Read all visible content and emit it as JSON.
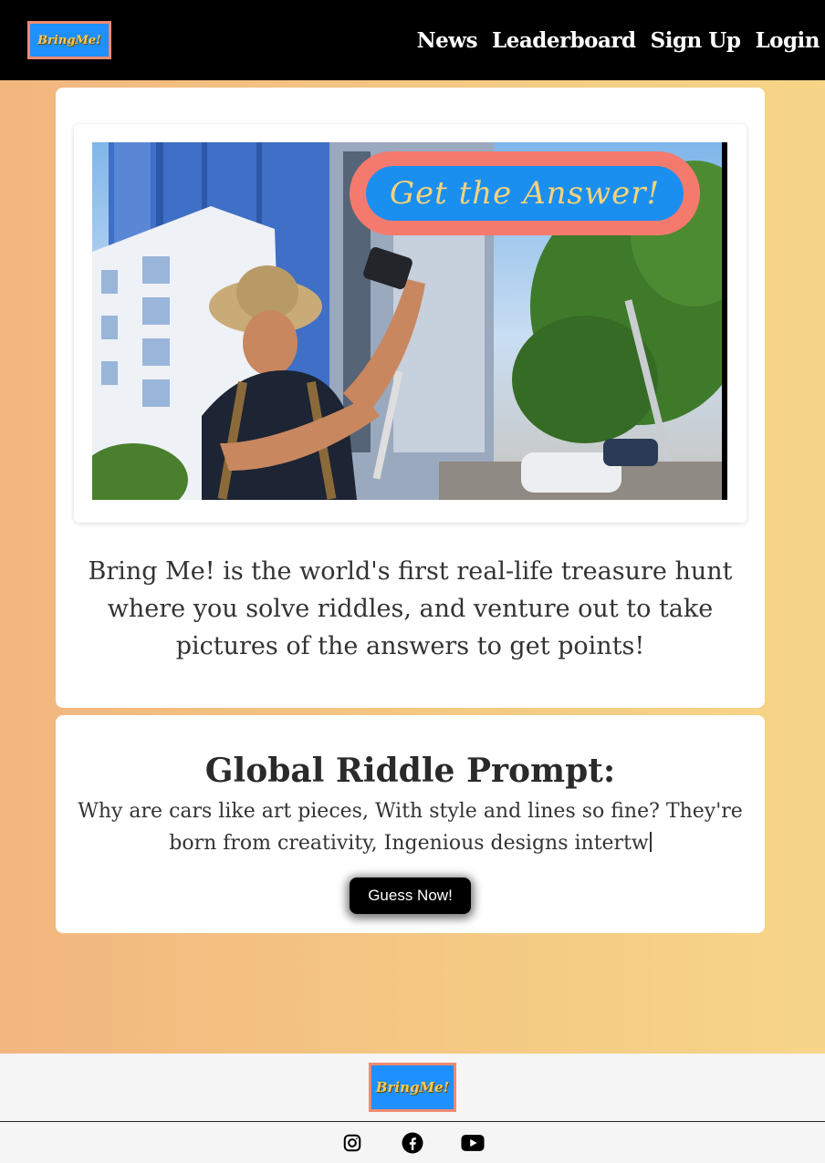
{
  "brand": {
    "logo_text": "BringMe!"
  },
  "nav": {
    "links": [
      {
        "label": "News"
      },
      {
        "label": "Leaderboard"
      },
      {
        "label": "Sign Up"
      },
      {
        "label": "Login"
      }
    ]
  },
  "hero": {
    "badge_text": "Get the Answer!",
    "description": "Bring Me! is the world's first real-life treasure hunt where you solve riddles, and venture out to take pictures of the answers to get points!"
  },
  "riddle": {
    "title": "Global Riddle Prompt:",
    "text": "Why are cars like art pieces, With style and lines so fine? They're born from creativity, Ingenious designs intertw",
    "button_label": "Guess Now!"
  },
  "footer": {
    "logo_text": "BringMe!",
    "social_icons": [
      "instagram-icon",
      "facebook-icon",
      "youtube-icon"
    ]
  },
  "colors": {
    "nav_bg": "#000000",
    "gradient_start": "#f2b67f",
    "gradient_end": "#f6d588",
    "logo_bg": "#1e90ff",
    "logo_border": "#f08a70",
    "badge_outer": "#f57a6e",
    "badge_inner": "#1a8ff0",
    "badge_text": "#f7d27a"
  }
}
